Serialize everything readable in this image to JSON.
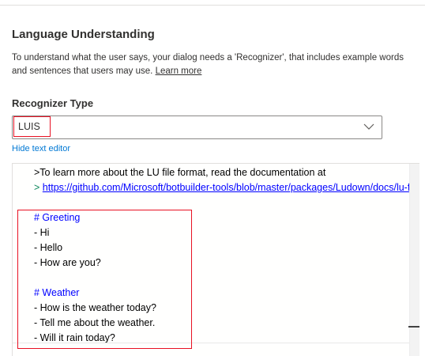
{
  "section": {
    "title": "Language Understanding",
    "description": "To understand what the user says, your dialog needs a 'Recognizer', that includes example words and sentences that users may use.",
    "learn_more": "Learn more"
  },
  "recognizer": {
    "label": "Recognizer Type",
    "selected": "LUIS",
    "chevron_icon": "chevron-down-icon"
  },
  "hide_editor_link": "Hide text editor",
  "editor": {
    "intro_text": ">To learn more about the LU file format, read the documentation at",
    "url_prefix": ">",
    "url": "https://github.com/Microsoft/botbuilder-tools/blob/master/packages/Ludown/docs/lu-file-format.md",
    "greeting_heading": "# Greeting",
    "greeting_items": [
      "- Hi",
      "- Hello",
      "- How are you?"
    ],
    "weather_heading": "# Weather",
    "weather_items": [
      "- How is the weather today?",
      "- Tell me about the weather.",
      "- Will it rain today?"
    ]
  },
  "colors": {
    "annotation_red": "#e81123",
    "link_blue": "#0078d4",
    "code_blue": "#0000ff",
    "code_green": "#098658"
  }
}
